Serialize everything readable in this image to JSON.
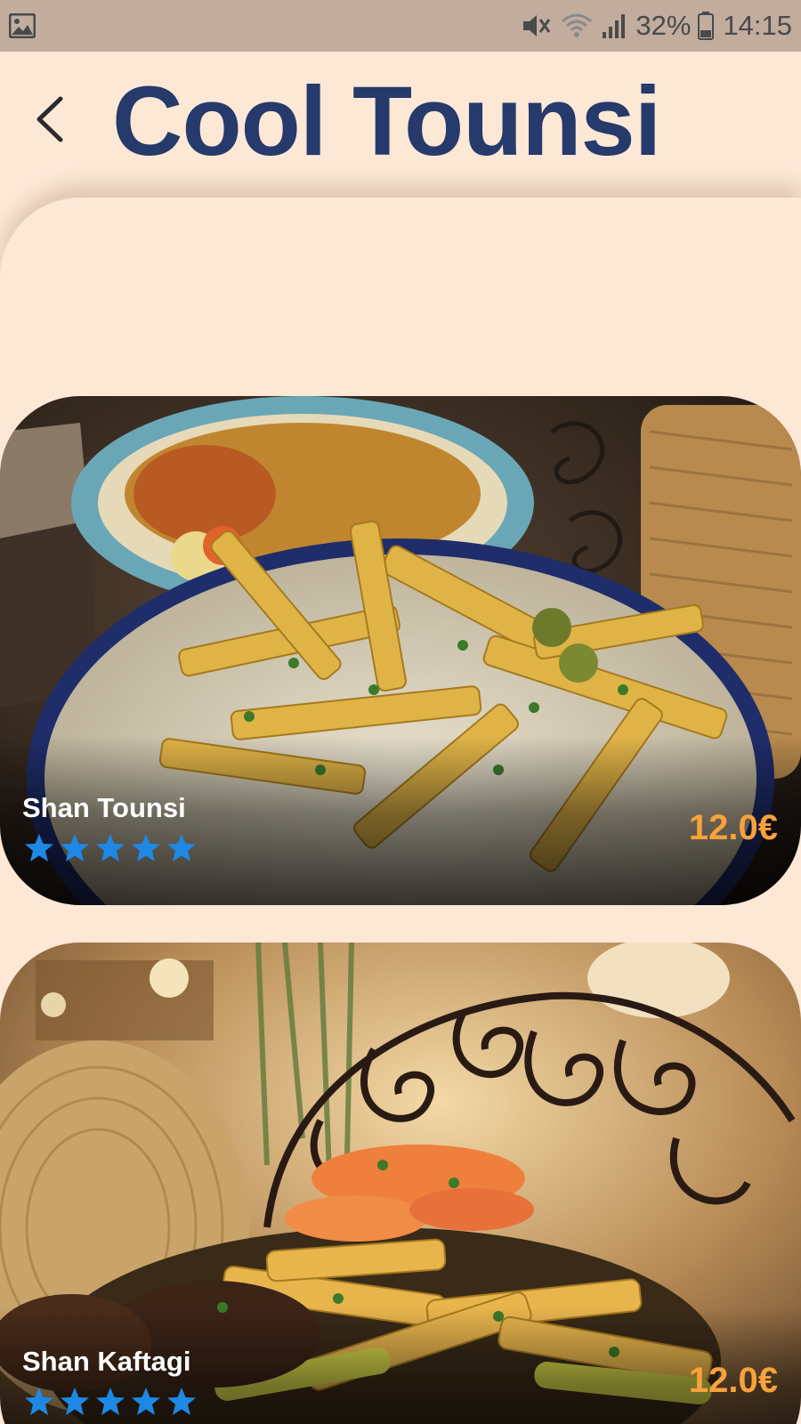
{
  "status_bar": {
    "battery": "32%",
    "time": "14:15",
    "icons": [
      "image-icon",
      "mute-icon",
      "wifi-icon",
      "signal-icon",
      "battery-icon"
    ]
  },
  "header": {
    "title": "Cool Tounsi",
    "back_icon": "chevron-left-icon"
  },
  "theme": {
    "background": "#fde8d6",
    "status_bar": "#c2ac9d",
    "title_color": "#263a6b",
    "price_color": "#f7a23a",
    "star_color": "#1e88e5"
  },
  "dishes": [
    {
      "name": "Shan Tounsi",
      "price": "12.0€",
      "rating": 5
    },
    {
      "name": "Shan Kaftagi",
      "price": "12.0€",
      "rating": 5
    }
  ]
}
